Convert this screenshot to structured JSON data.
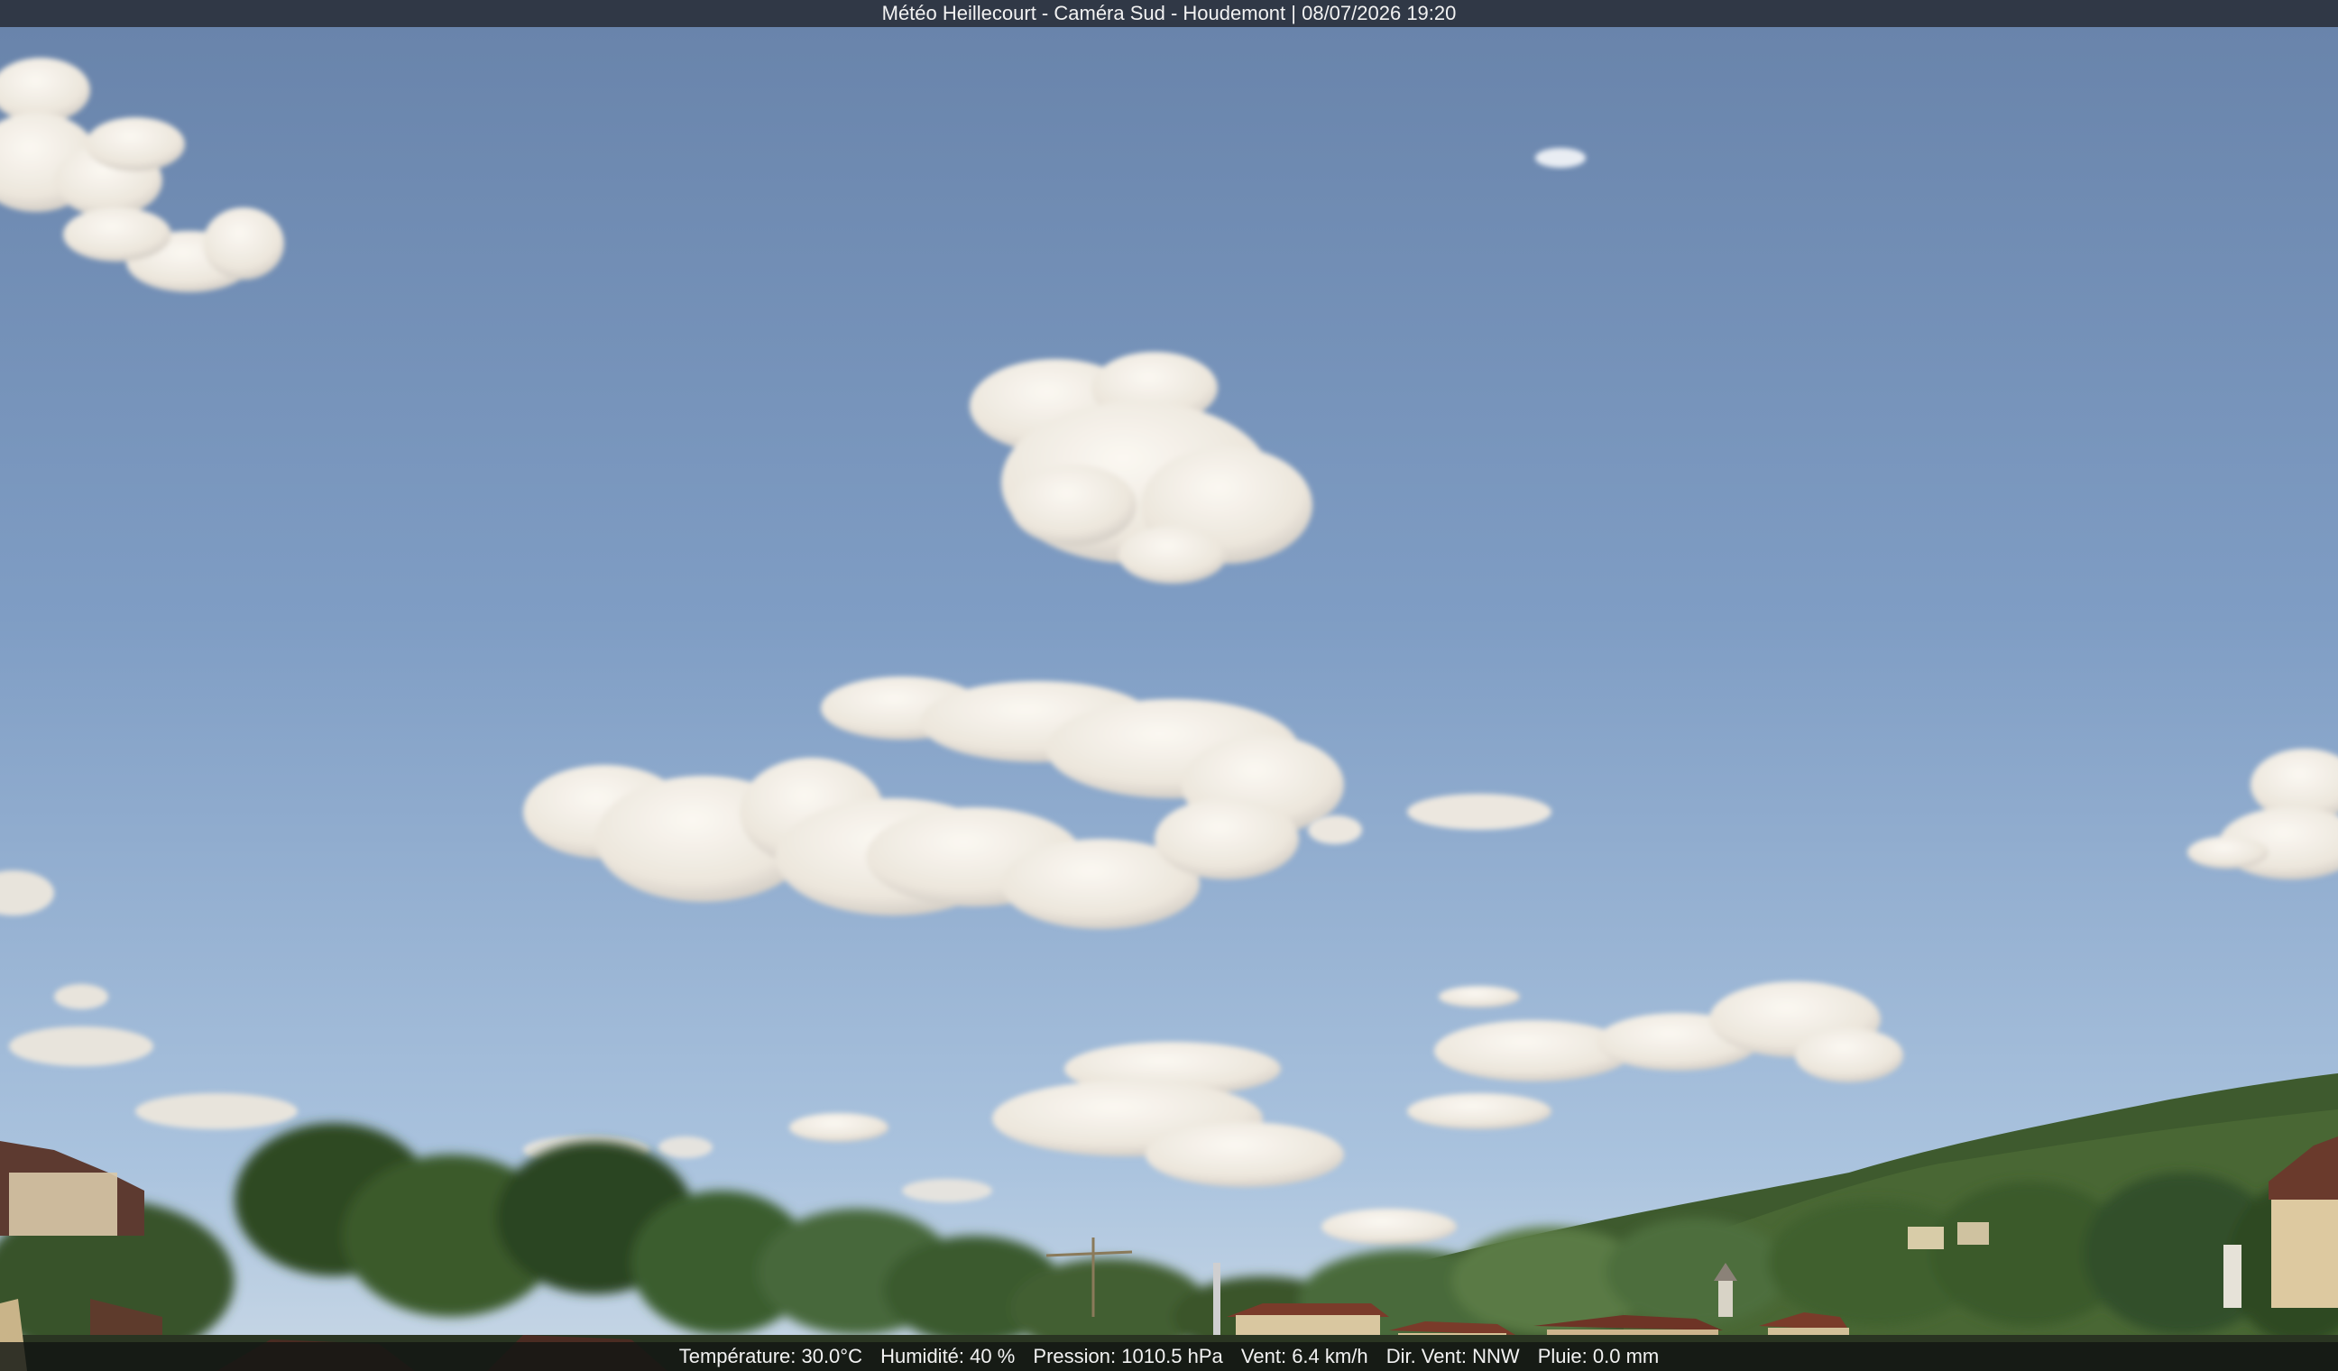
{
  "overlay": {
    "title": "Météo Heillecourt - Caméra Sud - Houdemont | 08/07/2026 19:20",
    "readings": {
      "temperature": "Température: 30.0°C",
      "humidity": "Humidité: 40 %",
      "pressure": "Pression: 1010.5 hPa",
      "wind": "Vent: 6.4 km/h",
      "wind_direction": "Dir. Vent: NNW",
      "rain": "Pluie: 0.0 mm"
    }
  },
  "scene": {
    "sky_top_color": "#6a86ad",
    "sky_bottom_color": "#c9d9ea",
    "cloud_color": "#f6f2ea",
    "cloud_shadow_color": "#cfc9c0",
    "hill_color": "#2e4a26",
    "tree_color": "#3a5a2c",
    "roof_color": "#7a3b2a",
    "wall_color": "#d9c7a0"
  }
}
